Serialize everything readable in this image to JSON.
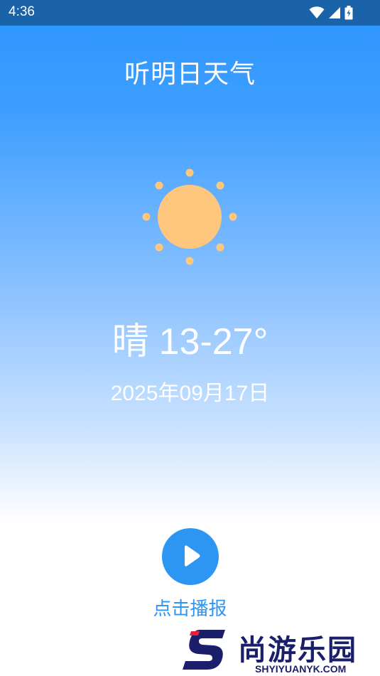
{
  "status_bar": {
    "time": "4:36",
    "icons": [
      "wifi-icon",
      "cellular-signal-icon",
      "battery-icon"
    ]
  },
  "app": {
    "title": "听明日天气"
  },
  "weather": {
    "condition": "晴",
    "temperature_range": "13-27°",
    "date": "2025年09月17日",
    "icon": "sun-icon"
  },
  "play": {
    "label": "点击播报",
    "icon": "play-icon"
  },
  "watermark": {
    "title": "尚游乐园",
    "url": "SHYIYUANYK.COM"
  },
  "colors": {
    "status_bar_bg": "#1a63a8",
    "gradient_top": "#2d96ff",
    "sun": "#ffc77d",
    "accent": "#2d96f3",
    "watermark": "#1b1f6b",
    "watermark_accent": "#e8213b"
  }
}
